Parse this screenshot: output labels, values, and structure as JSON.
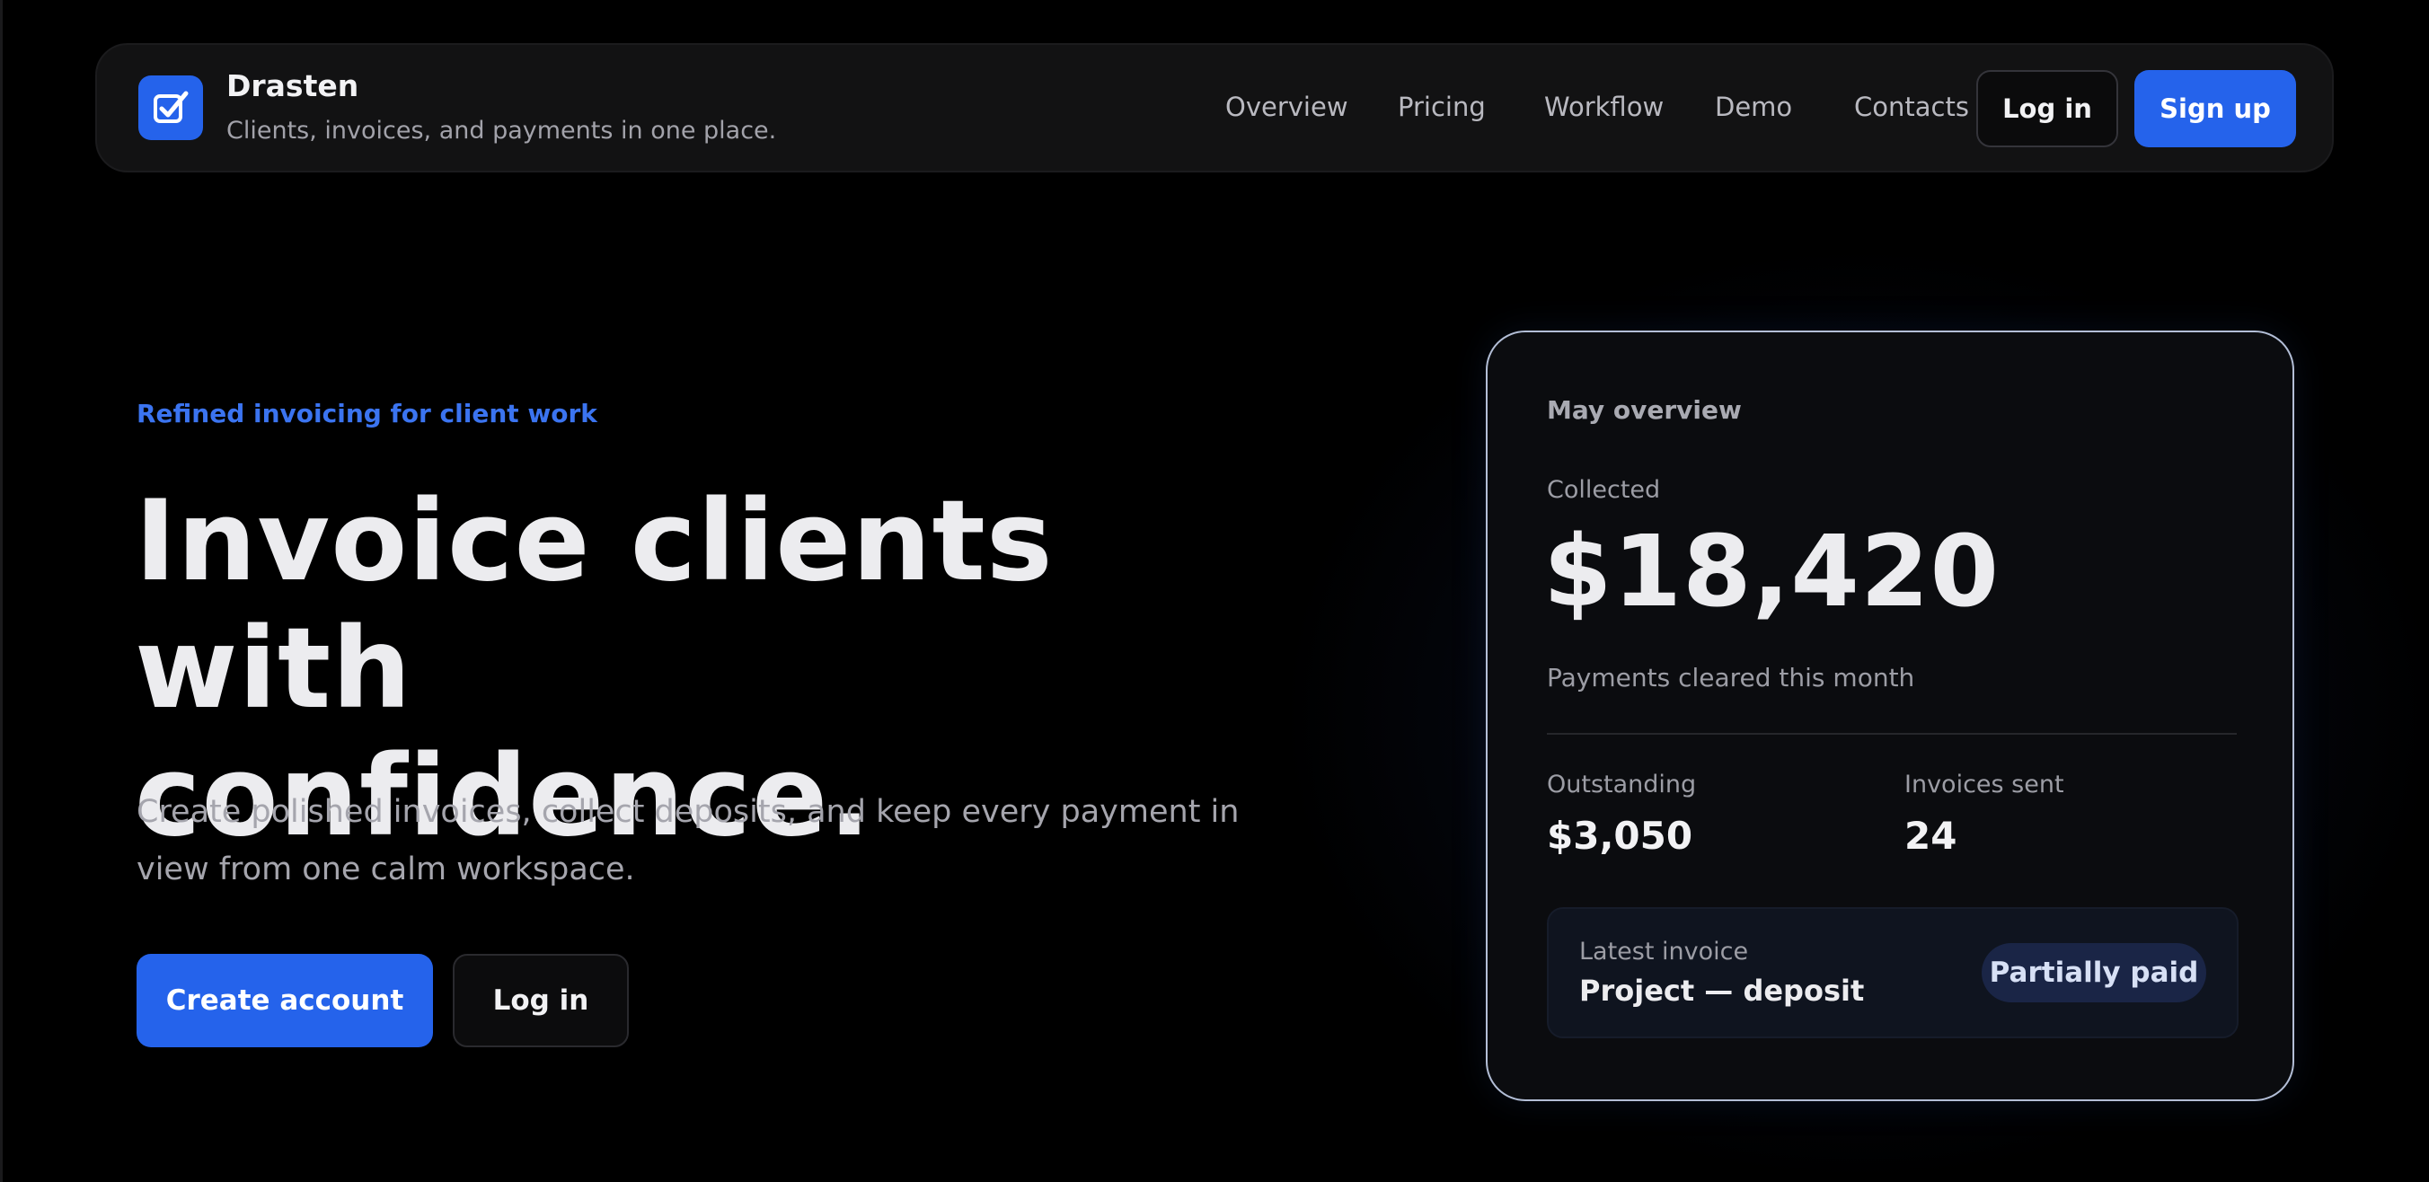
{
  "brand": {
    "name": "Drasten",
    "tagline": "Clients, invoices, and payments in one place.",
    "logo_icon": "check-square-icon",
    "accent": "#2563eb"
  },
  "nav": {
    "links": [
      "Overview",
      "Pricing",
      "Workflow",
      "Demo",
      "Contacts"
    ],
    "login_label": "Log in",
    "signup_label": "Sign up"
  },
  "hero": {
    "eyebrow": "Refined invoicing for client work",
    "headline_line1": "Invoice clients with",
    "headline_line2": "confidence.",
    "subcopy": "Create polished invoices, collect deposits, and keep every payment in view from one calm workspace.",
    "primary_cta": "Create account",
    "secondary_cta": "Log in"
  },
  "overview_card": {
    "title": "May overview",
    "collected_label": "Collected",
    "collected_amount": "$18,420",
    "collected_sub": "Payments cleared this month",
    "outstanding_label": "Outstanding",
    "outstanding_value": "$3,050",
    "invoices_label": "Invoices sent",
    "invoices_value": "24",
    "latest_label": "Latest invoice",
    "latest_value": "Project — deposit",
    "status_badge": "Partially paid"
  }
}
